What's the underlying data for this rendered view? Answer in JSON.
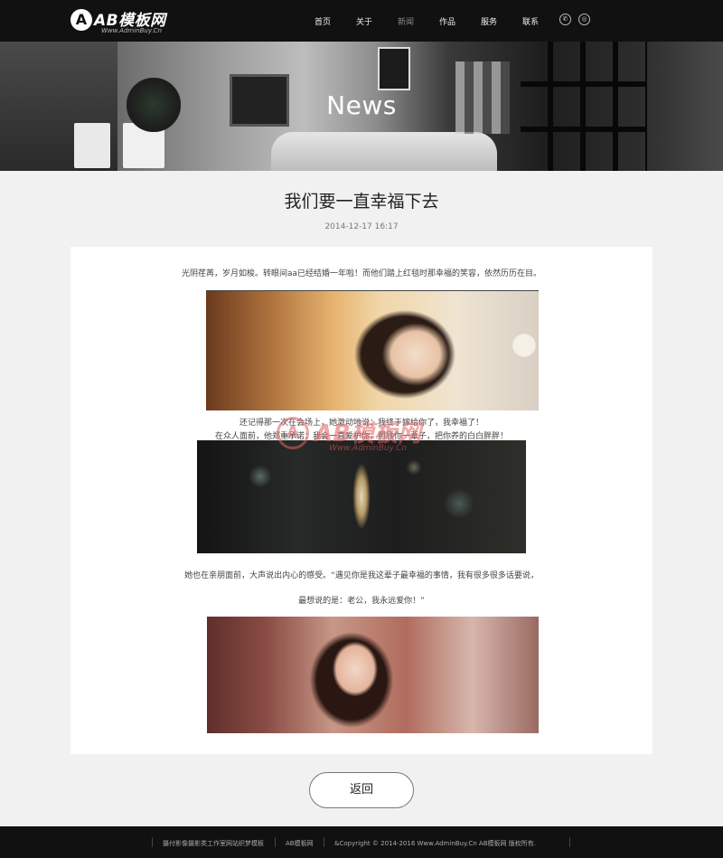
{
  "header": {
    "logo": {
      "mark": "A",
      "name": "AB模板网",
      "url": "Www.AdminBuy.Cn"
    },
    "nav": [
      {
        "label": "首页",
        "active": false
      },
      {
        "label": "关于",
        "active": false
      },
      {
        "label": "新闻",
        "active": true
      },
      {
        "label": "作品",
        "active": false
      },
      {
        "label": "服务",
        "active": false
      },
      {
        "label": "联系",
        "active": false
      }
    ],
    "icons": [
      {
        "name": "phone-icon",
        "glyph": "✆"
      },
      {
        "name": "wechat-icon",
        "glyph": "◎"
      }
    ]
  },
  "banner": {
    "title": "News"
  },
  "article": {
    "title": "我们要一直幸福下去",
    "date": "2014-12-17 16:17",
    "paragraphs": [
      "光阴荏苒，岁月如梭。转眼间aa已经结婚一年啦！而他们踏上红毯时那幸福的笑容，依然历历在目。",
      "还记得那一次在会场上，她激动地说：我终于嫁给你了，我幸福了！",
      "在众人面前，他郑重承诺：我会一直爱护你，照顾你一辈子，把你养的白白胖胖！",
      "她也在亲朋面前，大声说出内心的感受。“遇见你是我这辈子最幸福的事情，我有很多很多话要说，",
      "最想说的是：老公，我永远爱你！”"
    ],
    "watermark": {
      "mark": "A",
      "name": "AB模板网",
      "url": "Www.AdminBuy.Cn"
    }
  },
  "back_label": "返回",
  "footer": {
    "items": [
      "摄付影像摄影类工作室网站织梦模板",
      "AB模板网",
      "&Copyright © 2014-2016 Www.AdminBuy.Cn AB模板网 版权所有."
    ]
  },
  "colors": {
    "topbar": "#111111",
    "page_bg": "#f1f1f1",
    "card_bg": "#ffffff",
    "watermark": "#e06060"
  }
}
